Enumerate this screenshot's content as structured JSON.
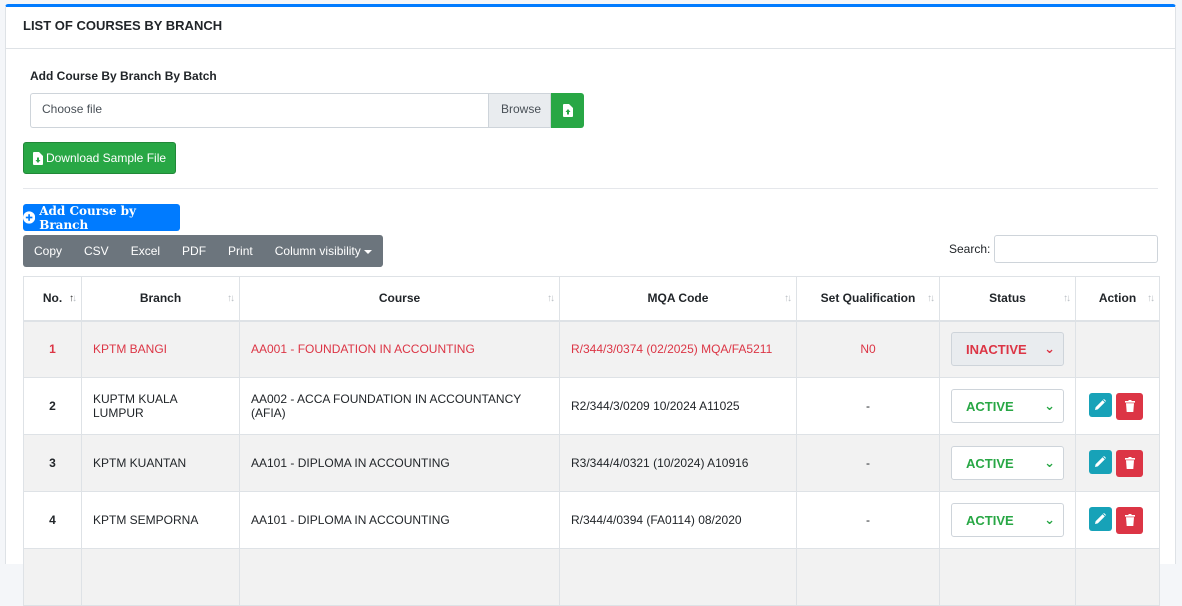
{
  "page": {
    "title": "LIST OF COURSES BY BRANCH"
  },
  "upload": {
    "label": "Add Course By Branch By Batch",
    "placeholder": "Choose file",
    "browse_label": "Browse",
    "download_label": "Download Sample File"
  },
  "add_button_label": "Add Course by Branch",
  "export_buttons": [
    "Copy",
    "CSV",
    "Excel",
    "PDF",
    "Print",
    "Column visibility"
  ],
  "search": {
    "label": "Search:",
    "value": ""
  },
  "table": {
    "columns": [
      "No.",
      "Branch",
      "Course",
      "MQA Code",
      "Set Qualification",
      "Status",
      "Action"
    ],
    "rows": [
      {
        "no": "1",
        "branch": "KPTM BANGI",
        "course": "AA001 - FOUNDATION IN ACCOUNTING",
        "mqa": "R/344/3/0374 (02/2025) MQA/FA5211",
        "qual": "N0",
        "status": "INACTIVE"
      },
      {
        "no": "2",
        "branch": "KUPTM KUALA LUMPUR",
        "course": "AA002 - ACCA FOUNDATION IN ACCOUNTANCY (AFIA)",
        "mqa": "R2/344/3/0209 10/2024 A11025",
        "qual": "-",
        "status": "ACTIVE"
      },
      {
        "no": "3",
        "branch": "KPTM KUANTAN",
        "course": "AA101 - DIPLOMA IN ACCOUNTING",
        "mqa": "R3/344/4/0321 (10/2024) A10916",
        "qual": "-",
        "status": "ACTIVE"
      },
      {
        "no": "4",
        "branch": "KPTM SEMPORNA",
        "course": "AA101 - DIPLOMA IN ACCOUNTING",
        "mqa": "R/344/4/0394 (FA0114) 08/2020",
        "qual": "-",
        "status": "ACTIVE"
      }
    ]
  },
  "colors": {
    "primary": "#007bff",
    "success": "#28a745",
    "danger": "#dc3545",
    "info": "#17a2b8",
    "secondary": "#6c757d"
  },
  "icons": {
    "upload": "file-upload-icon",
    "download": "file-download-icon",
    "add": "plus-circle-icon",
    "edit": "pencil-icon",
    "delete": "trash-icon",
    "sort": "sort-arrows-icon"
  }
}
